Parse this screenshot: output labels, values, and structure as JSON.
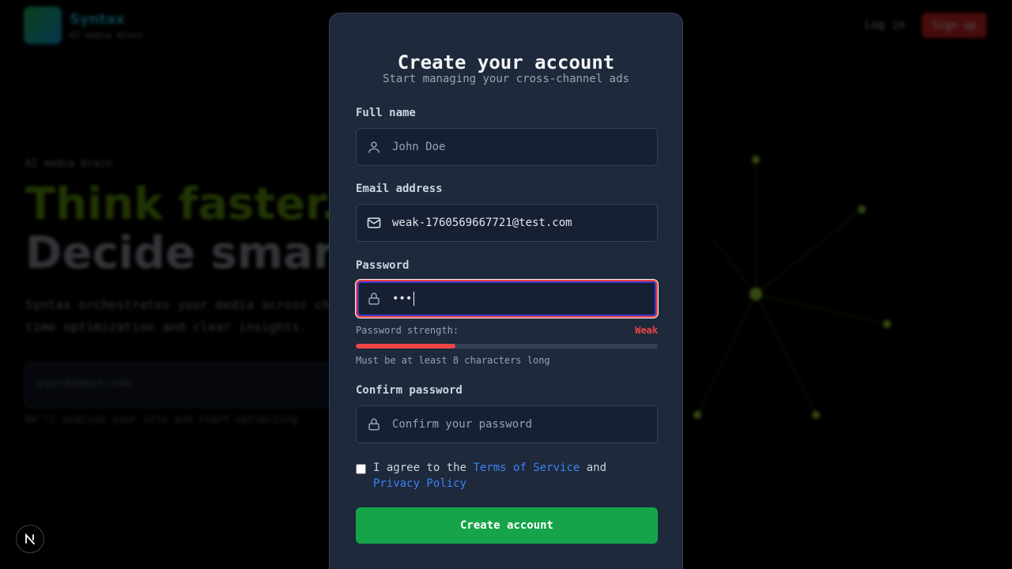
{
  "background": {
    "brand": "Syntax",
    "brand_sub": "AI media brain",
    "login": "Log in",
    "signup": "Sign up",
    "eyebrow": "AI media brain",
    "headline_1": "Think faster.",
    "headline_2": "Decide smarter.",
    "paragraph": "Syntax orchestrates your media across channels with real-time optimization and clear insights.",
    "input_placeholder": "yourdomain.com",
    "note": "We'll analyze your site and start optimizing"
  },
  "form": {
    "title": "Create your account",
    "subtitle": "Start managing your cross-channel ads",
    "full_name": {
      "label": "Full name",
      "placeholder": "John Doe",
      "icon": "user-icon"
    },
    "email": {
      "label": "Email address",
      "value": "weak-1760569667721@test.com",
      "icon": "mail-icon"
    },
    "password": {
      "label": "Password",
      "value": "•••",
      "icon": "lock-icon",
      "strength_label": "Password strength:",
      "strength_value": "Weak",
      "strength_fraction": 0.33,
      "hint": "Must be at least 8 characters long"
    },
    "confirm_password": {
      "label": "Confirm password",
      "placeholder": "Confirm your password",
      "icon": "lock-icon"
    },
    "agree": {
      "prefix": "I agree to the ",
      "terms": "Terms of Service",
      "middle": " and",
      "privacy": "Privacy Policy",
      "checked": false
    },
    "submit_label": "Create account"
  },
  "colors": {
    "accent_green": "#16a34a",
    "error_red": "#ef4444",
    "link_blue": "#3b82f6",
    "modal_bg": "#1e293b"
  }
}
